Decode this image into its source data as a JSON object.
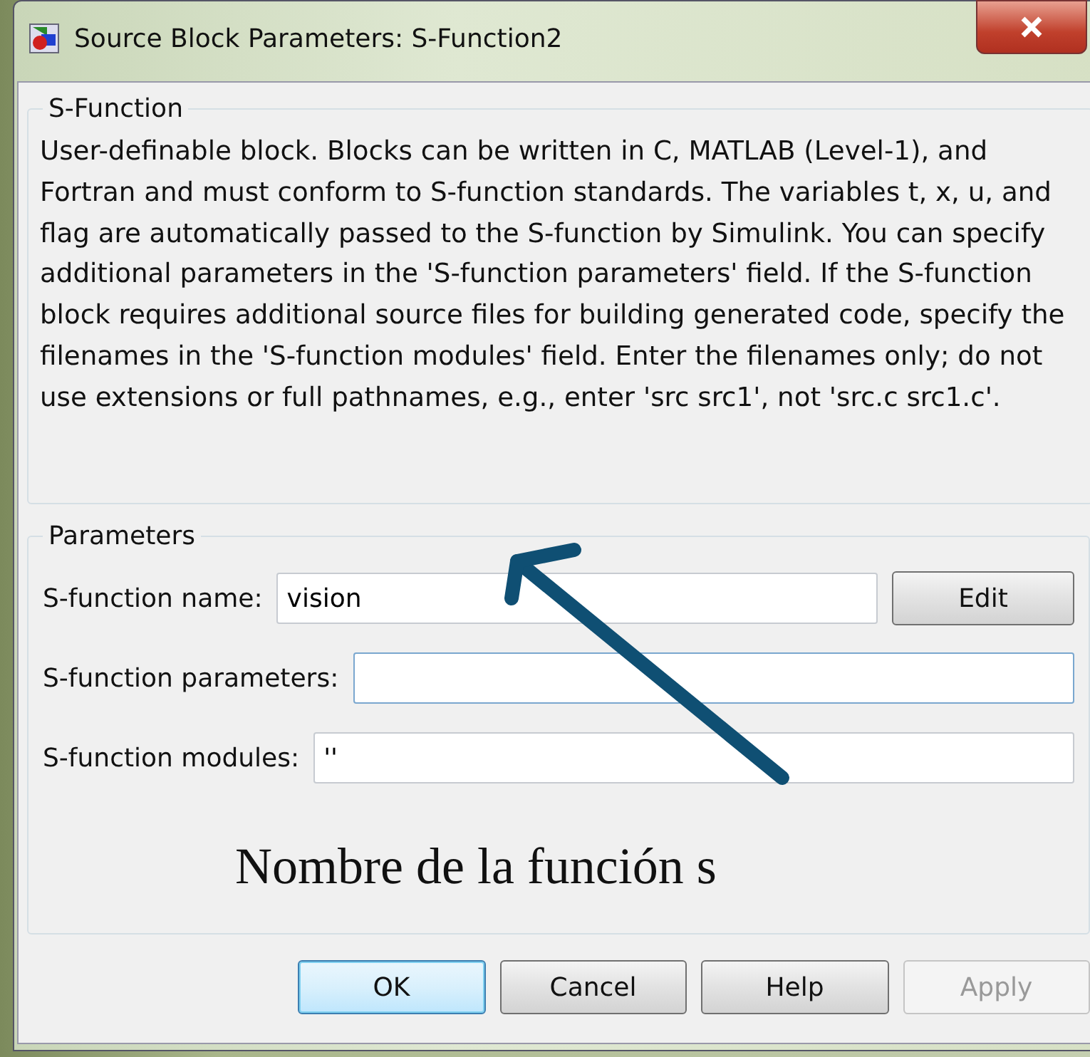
{
  "window": {
    "title": "Source Block Parameters: S-Function2"
  },
  "description_group": {
    "title": "S-Function",
    "text": "User-definable block.  Blocks can be written in C, MATLAB (Level-1), and Fortran and must conform to S-function standards.  The variables t, x, u, and flag are automatically passed to the S-function by Simulink.  You can specify additional parameters in the 'S-function parameters' field. If the S-function block requires additional source files for building generated code, specify the filenames in the 'S-function modules' field. Enter the filenames only; do not use extensions or full pathnames, e.g., enter 'src src1', not 'src.c src1.c'."
  },
  "parameters_group": {
    "title": "Parameters",
    "fields": [
      {
        "label": "S-function name:",
        "value": "vision",
        "focused": false,
        "button": "Edit"
      },
      {
        "label": "S-function parameters:",
        "focused": true
      },
      {
        "label": "S-function modules:",
        "value": "''",
        "focused": false
      }
    ]
  },
  "annotation": {
    "text": "Nombre de la función s"
  },
  "buttons": [
    {
      "label": "OK",
      "default": true,
      "disabled": false
    },
    {
      "label": "Cancel",
      "default": false,
      "disabled": false
    },
    {
      "label": "Help",
      "default": false,
      "disabled": false
    },
    {
      "label": "Apply",
      "default": false,
      "disabled": true
    }
  ]
}
